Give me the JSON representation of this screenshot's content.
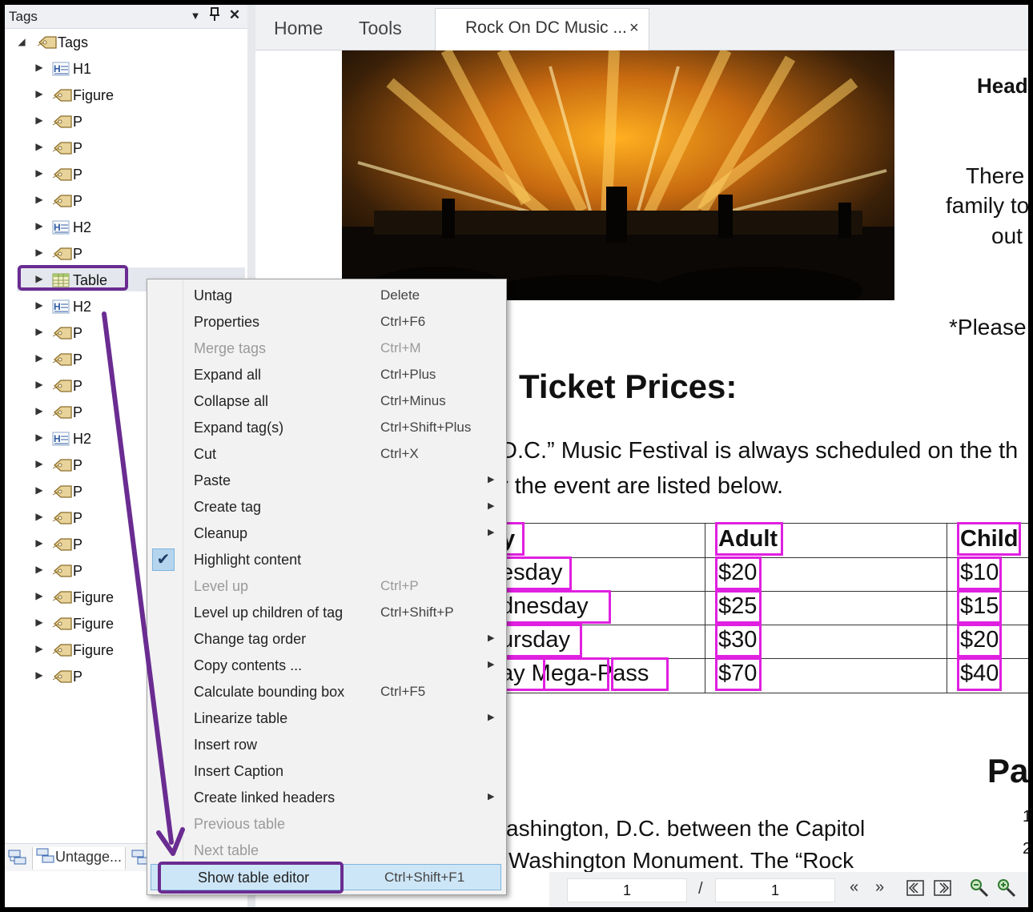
{
  "tags_panel": {
    "title": "Tags",
    "menu_icon": "triangle-down-icon",
    "pin_icon": "pin-icon",
    "close_icon": "close-icon",
    "root_label": "Tags",
    "items": [
      {
        "label": "H1",
        "icon": "heading-tag-icon"
      },
      {
        "label": "Figure",
        "icon": "tag-icon"
      },
      {
        "label": "P",
        "icon": "tag-icon"
      },
      {
        "label": "P",
        "icon": "tag-icon"
      },
      {
        "label": "P",
        "icon": "tag-icon"
      },
      {
        "label": "P",
        "icon": "tag-icon"
      },
      {
        "label": "H2",
        "icon": "heading-tag-icon"
      },
      {
        "label": "P",
        "icon": "tag-icon"
      },
      {
        "label": "Table",
        "icon": "table-tag-icon"
      },
      {
        "label": "H2",
        "icon": "heading-tag-icon"
      },
      {
        "label": "P",
        "icon": "tag-icon"
      },
      {
        "label": "P",
        "icon": "tag-icon"
      },
      {
        "label": "P",
        "icon": "tag-icon"
      },
      {
        "label": "P",
        "icon": "tag-icon"
      },
      {
        "label": "H2",
        "icon": "heading-tag-icon"
      },
      {
        "label": "P",
        "icon": "tag-icon"
      },
      {
        "label": "P",
        "icon": "tag-icon"
      },
      {
        "label": "P",
        "icon": "tag-icon"
      },
      {
        "label": "P",
        "icon": "tag-icon"
      },
      {
        "label": "P",
        "icon": "tag-icon"
      },
      {
        "label": "Figure",
        "icon": "tag-icon"
      },
      {
        "label": "Figure",
        "icon": "tag-icon"
      },
      {
        "label": "Figure",
        "icon": "tag-icon"
      },
      {
        "label": "P",
        "icon": "tag-icon"
      }
    ],
    "bottom_tabs": [
      "Untagge..."
    ]
  },
  "tabbar": {
    "home": "Home",
    "tools": "Tools",
    "doc_tab": "Rock On DC Music ...",
    "doc_tab_close": "×"
  },
  "document": {
    "heading_partial": "Headl",
    "side_text": [
      "There i",
      "family to",
      "out"
    ],
    "please_text": "*Please",
    "ticket_heading": "Ticket Prices:",
    "body_line1": "D.C.” Music Festival is always scheduled on the th",
    "body_line2": "r the event are listed below.",
    "table": {
      "headers": [
        "y",
        "Adult",
        "Child"
      ],
      "rows": [
        [
          "esday",
          "$20",
          "$10"
        ],
        [
          "dnesday",
          "$25",
          "$15"
        ],
        [
          "ursday",
          "$30",
          "$20"
        ],
        [
          "ay Mega-Pass",
          "$70",
          "$40"
        ]
      ]
    },
    "par_heading": "Par",
    "bottom_line1": "ashington, D.C. between the Capitol",
    "bottom_line2": "Washington Monument.  The “Rock",
    "margin_nums": [
      "1",
      "2"
    ]
  },
  "context_menu": {
    "items": [
      {
        "label": "Untag",
        "shortcut": "Delete",
        "disabled": false,
        "submenu": false
      },
      {
        "label": "Properties",
        "shortcut": "Ctrl+F6",
        "disabled": false,
        "submenu": false
      },
      {
        "label": "Merge tags",
        "shortcut": "Ctrl+M",
        "disabled": true,
        "submenu": false
      },
      {
        "label": "Expand all",
        "shortcut": "Ctrl+Plus",
        "disabled": false,
        "submenu": false
      },
      {
        "label": "Collapse all",
        "shortcut": "Ctrl+Minus",
        "disabled": false,
        "submenu": false
      },
      {
        "label": "Expand tag(s)",
        "shortcut": "Ctrl+Shift+Plus",
        "disabled": false,
        "submenu": false
      },
      {
        "label": "Cut",
        "shortcut": "Ctrl+X",
        "disabled": false,
        "submenu": false
      },
      {
        "label": "Paste",
        "shortcut": "",
        "disabled": false,
        "submenu": true
      },
      {
        "label": "Create tag",
        "shortcut": "",
        "disabled": false,
        "submenu": true
      },
      {
        "label": "Cleanup",
        "shortcut": "",
        "disabled": false,
        "submenu": true
      },
      {
        "label": "Highlight content",
        "shortcut": "",
        "disabled": false,
        "submenu": false,
        "checked": true
      },
      {
        "label": "Level up",
        "shortcut": "Ctrl+P",
        "disabled": true,
        "submenu": false
      },
      {
        "label": "Level up children of tag",
        "shortcut": "Ctrl+Shift+P",
        "disabled": false,
        "submenu": false
      },
      {
        "label": "Change tag order",
        "shortcut": "",
        "disabled": false,
        "submenu": true
      },
      {
        "label": "Copy contents ...",
        "shortcut": "",
        "disabled": false,
        "submenu": true
      },
      {
        "label": "Calculate bounding box",
        "shortcut": "Ctrl+F5",
        "disabled": false,
        "submenu": false
      },
      {
        "label": "Linearize table",
        "shortcut": "",
        "disabled": false,
        "submenu": true
      },
      {
        "label": "Insert row",
        "shortcut": "",
        "disabled": false,
        "submenu": false
      },
      {
        "label": "Insert Caption",
        "shortcut": "",
        "disabled": false,
        "submenu": false
      },
      {
        "label": "Create linked headers",
        "shortcut": "",
        "disabled": false,
        "submenu": true
      },
      {
        "label": "Previous table",
        "shortcut": "",
        "disabled": true,
        "submenu": false
      },
      {
        "label": "Next table",
        "shortcut": "",
        "disabled": true,
        "submenu": false
      },
      {
        "label": "Show table editor",
        "shortcut": "Ctrl+Shift+F1",
        "disabled": false,
        "submenu": false,
        "highlighted": true
      }
    ],
    "checkmark": "✔",
    "submenu_arrow": "▶"
  },
  "bottom_bar": {
    "current_page": "1",
    "separator": "/",
    "total_pages": "1",
    "prev_icon": "double-chevron-left-icon",
    "next_icon": "double-chevron-right-icon",
    "first_icon": "first-page-icon",
    "last_icon": "last-page-icon",
    "zoom_out_icon": "zoom-out-icon",
    "zoom_in_icon": "zoom-in-icon"
  },
  "colors": {
    "annotation_purple": "#6a2c91",
    "highlight_magenta": "#e020e0",
    "menu_hover": "#cde6f7"
  }
}
